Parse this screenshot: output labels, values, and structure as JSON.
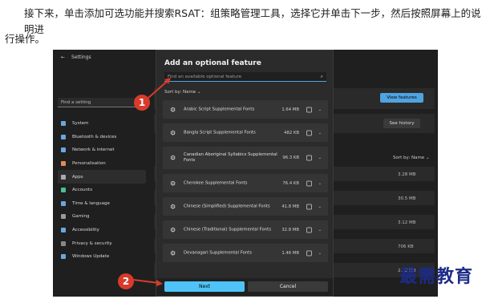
{
  "article": {
    "line1": "接下来，单击添加可选功能并搜索RSAT：组策略管理工具，选择它并单击下一步，然后按照屏幕上的说明进",
    "line2": "行操作。"
  },
  "settings": {
    "title": "Settings",
    "search_placeholder": "Find a setting",
    "nav": [
      {
        "label": "System",
        "icon": "system-icon"
      },
      {
        "label": "Bluetooth & devices",
        "icon": "bluetooth-icon"
      },
      {
        "label": "Network & internet",
        "icon": "network-icon"
      },
      {
        "label": "Personalisation",
        "icon": "brush-icon"
      },
      {
        "label": "Apps",
        "icon": "apps-icon"
      },
      {
        "label": "Accounts",
        "icon": "account-icon"
      },
      {
        "label": "Time & language",
        "icon": "clock-icon"
      },
      {
        "label": "Gaming",
        "icon": "gaming-icon"
      },
      {
        "label": "Accessibility",
        "icon": "accessibility-icon"
      },
      {
        "label": "Privacy & security",
        "icon": "shield-icon"
      },
      {
        "label": "Windows Update",
        "icon": "update-icon"
      }
    ],
    "view_features": "View features",
    "see_history": "See history",
    "sort_right": "Sort by: Name",
    "sizes": [
      "3.28 MB",
      "30.5 MB",
      "3.12 MB",
      "706 KB",
      "2.12 MB"
    ]
  },
  "dialog": {
    "title": "Add an optional feature",
    "search_placeholder": "Find an available optional feature",
    "sort_label": "Sort by: Name",
    "features": [
      {
        "name": "Arabic Script Supplemental Fonts",
        "size": "1.64 MB"
      },
      {
        "name": "Bangla Script Supplemental Fonts",
        "size": "482 KB"
      },
      {
        "name": "Canadian Aboriginal Syllabics Supplemental Fonts",
        "size": "96.3 KB"
      },
      {
        "name": "Cherokee Supplemental Fonts",
        "size": "76.4 KB"
      },
      {
        "name": "Chinese (Simplified) Supplemental Fonts",
        "size": "41.8 MB"
      },
      {
        "name": "Chinese (Traditional) Supplemental Fonts",
        "size": "32.8 MB"
      },
      {
        "name": "Devanagari Supplemental Fonts",
        "size": "1.46 MB"
      }
    ],
    "next": "Next",
    "cancel": "Cancel"
  },
  "markers": [
    "1",
    "2"
  ],
  "watermark": "最需教育"
}
